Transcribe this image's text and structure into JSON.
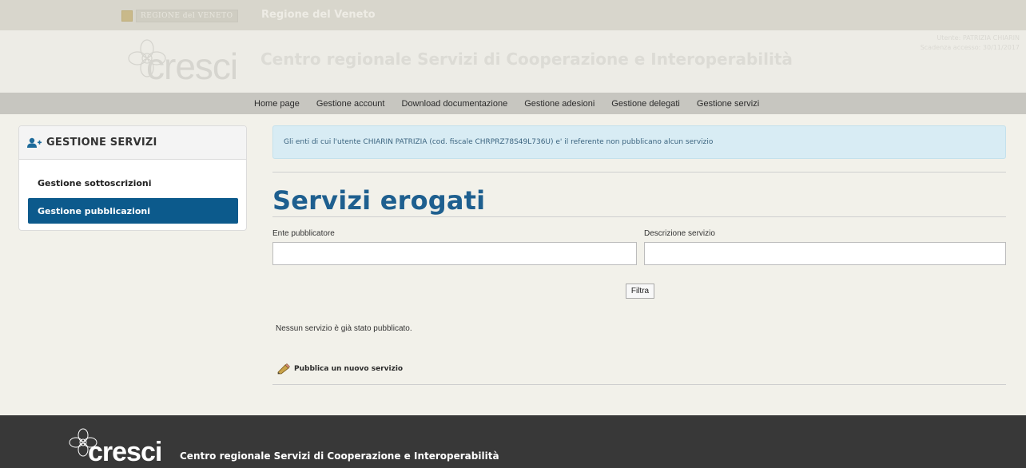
{
  "top_strip": {
    "region_badge": "REGIONE del VENETO",
    "region_name": "Regione del Veneto"
  },
  "header": {
    "logo_text": "cresci",
    "site_title": "Centro regionale Servizi di Cooperazione e Interoperabilità",
    "user_line": "Utente: PATRIZIA CHIARIN",
    "session_line": "Scadenza accesso: 30/11/2017"
  },
  "nav": {
    "items": [
      {
        "label": "Home page"
      },
      {
        "label": "Gestione account"
      },
      {
        "label": "Download documentazione"
      },
      {
        "label": "Gestione adesioni"
      },
      {
        "label": "Gestione delegati"
      },
      {
        "label": "Gestione servizi"
      }
    ]
  },
  "sidebar": {
    "title": "GESTIONE SERVIZI",
    "icon": "add-user-icon",
    "items": [
      {
        "label": "Gestione sottoscrizioni",
        "active": false
      },
      {
        "label": "Gestione pubblicazioni",
        "active": true
      }
    ]
  },
  "main": {
    "alert_text": "Gli enti di cui l'utente CHIARIN PATRIZIA (cod. fiscale CHRPRZ78S49L736U) e' il referente non pubblicano alcun servizio",
    "page_title": "Servizi erogati",
    "filters": {
      "ente_label": "Ente pubblicatore",
      "ente_value": "",
      "descr_label": "Descrizione servizio",
      "descr_value": "",
      "filter_button": "Filtra"
    },
    "empty_message": "Nessun servizio è già stato pubblicato.",
    "publish_link": "Pubblica un nuovo servizio",
    "publish_icon": "pencil-icon"
  },
  "footer": {
    "logo_text": "cresci",
    "title": "Centro regionale Servizi di Cooperazione e Interoperabilità"
  },
  "colors": {
    "primary_blue": "#0c5a8c",
    "title_blue": "#1e5f8f",
    "alert_bg": "#d8ecf4",
    "footer_bg": "#383838"
  }
}
